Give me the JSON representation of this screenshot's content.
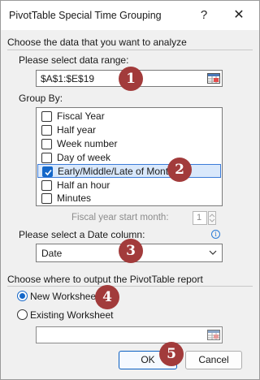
{
  "window": {
    "title": "PivotTable Special Time Grouping",
    "help_glyph": "?",
    "close_glyph": "✕"
  },
  "data_section": {
    "heading": "Choose the data that you want to analyze",
    "range_label": "Please select data range:",
    "range_value": "$A$1:$E$19"
  },
  "group_by": {
    "label": "Group By:",
    "items": [
      {
        "label": "Fiscal Year",
        "checked": false
      },
      {
        "label": "Half year",
        "checked": false
      },
      {
        "label": "Week number",
        "checked": false
      },
      {
        "label": "Day of week",
        "checked": false
      },
      {
        "label": "Early/Middle/Late of Month",
        "checked": true
      },
      {
        "label": "Half an hour",
        "checked": false
      },
      {
        "label": "Minutes",
        "checked": false
      }
    ]
  },
  "fiscal": {
    "label": "Fiscal year start month:",
    "value": "1"
  },
  "date_column": {
    "label": "Please select a Date column:",
    "info_glyph": "i",
    "selected": "Date"
  },
  "output_section": {
    "heading": "Choose where to output the PivotTable report",
    "options": [
      {
        "label": "New Worksheet",
        "selected": true
      },
      {
        "label": "Existing Worksheet",
        "selected": false
      }
    ],
    "location_value": ""
  },
  "buttons": {
    "ok": "OK",
    "cancel": "Cancel"
  },
  "badges": [
    "1",
    "2",
    "3",
    "4",
    "5"
  ],
  "colors": {
    "badge": "#a23b3b",
    "accent": "#1467c9",
    "selection": "#d9e8fb"
  }
}
